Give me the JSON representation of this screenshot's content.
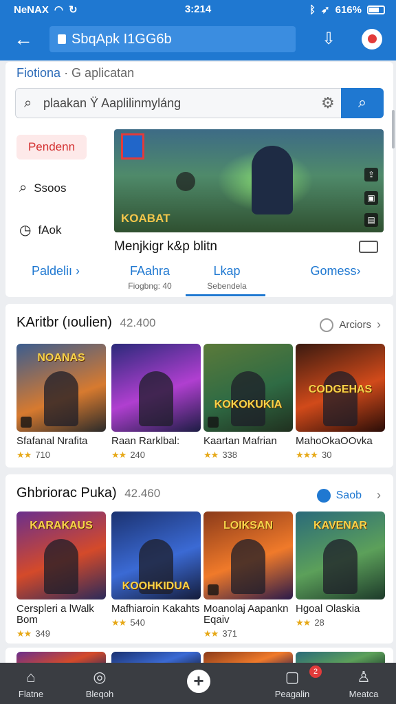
{
  "status": {
    "carrier": "NeNAX",
    "time": "3:214",
    "battery": "616%"
  },
  "appbar": {
    "url": "SbqApk I1GG6b"
  },
  "header": {
    "title": "Fiotiona",
    "subtitle": "· G aplicatan",
    "search_value": "plaakan Ÿ Aaplilinmyláng",
    "side_red": "Pendenn",
    "side_search": "Ssoos",
    "side_clock": "fAok",
    "banner_text": "KOABAT",
    "caption": "Menjkigr k&p blitn",
    "tabs": [
      {
        "label": "Paldeliı ›",
        "small": ""
      },
      {
        "label": "FAahra",
        "small": "Fiogbng: 40"
      },
      {
        "label": "Lkap",
        "small": "Sebendela"
      },
      {
        "label": "Gomess›",
        "small": ""
      }
    ]
  },
  "section1": {
    "title": "KAritbr (ıoulien)",
    "count": "42.400",
    "action": "Arciors",
    "items": [
      {
        "thumb_text": "NOANAS",
        "name": "Sfafanal Nrafita",
        "stars": "★★",
        "rating": "710"
      },
      {
        "thumb_text": "",
        "name": "Raan Rarklbal:",
        "stars": "★★",
        "rating": "240"
      },
      {
        "thumb_text": "KOKOKUKIA",
        "name": "Kaartan Mafrian",
        "stars": "★★",
        "rating": "338"
      },
      {
        "thumb_text": "CODGEHAS",
        "name": "MahoOkaOOvka",
        "stars": "★★★",
        "rating": "30"
      }
    ]
  },
  "section2": {
    "title": "Ghbriorac Puka)",
    "count": "42.460",
    "action": "Saob",
    "items": [
      {
        "thumb_text": "KARAKAUS",
        "name": "Cerspleri a lWalk Bom",
        "stars": "★★",
        "rating": "349"
      },
      {
        "thumb_text": "KOOHKIDUA",
        "name": "Mafhiaroin Kakahts",
        "stars": "★★",
        "rating": "540"
      },
      {
        "thumb_text": "LOIKSAN",
        "name": "Moanolaj Aapankn Eqaiv",
        "stars": "★★",
        "rating": "371"
      },
      {
        "thumb_text": "KAVENAR",
        "name": "Hgoal Olaskia",
        "stars": "★★",
        "rating": "28"
      }
    ]
  },
  "bottom_nav": [
    {
      "label": "Flatne",
      "icon": "home-icon"
    },
    {
      "label": "Bleqoh",
      "icon": "globe-icon"
    },
    {
      "label": "",
      "icon": "plus-icon"
    },
    {
      "label": "Peagalin",
      "icon": "chat-icon",
      "badge": "2"
    },
    {
      "label": "Meatca",
      "icon": "profile-icon"
    }
  ],
  "colors": {
    "primary": "#1f78d1",
    "nav_bg": "#3a3d42",
    "star": "#e6a817"
  }
}
